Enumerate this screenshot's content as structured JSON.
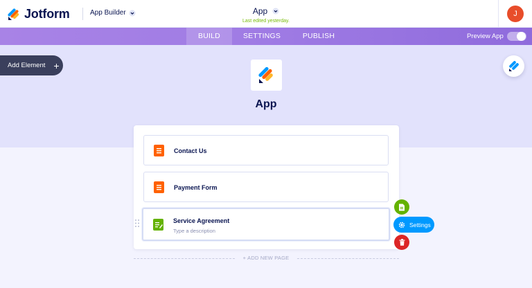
{
  "header": {
    "logo_text": "Jotform",
    "builder_label": "App Builder",
    "app_title": "App",
    "last_edited": "Last edited yesterday.",
    "avatar_initial": "J"
  },
  "nav": {
    "tabs": [
      {
        "label": "BUILD",
        "active": true
      },
      {
        "label": "SETTINGS",
        "active": false
      },
      {
        "label": "PUBLISH",
        "active": false
      }
    ],
    "preview_label": "Preview App",
    "preview_enabled": false
  },
  "hero": {
    "add_element_label": "Add Element",
    "app_name": "App"
  },
  "pages": [
    {
      "label": "Contact Us",
      "description": "",
      "icon": "form-icon",
      "color": "#ff6100"
    },
    {
      "label": "Payment Form",
      "description": "",
      "icon": "form-icon",
      "color": "#ff6100"
    },
    {
      "label": "Service Agreement",
      "description": "Type a description",
      "icon": "sign-document-icon",
      "color": "#64b200",
      "selected": true
    }
  ],
  "actions": {
    "settings_label": "Settings"
  },
  "footer": {
    "add_new_page": "+ ADD NEW PAGE"
  },
  "colors": {
    "brand_navy": "#0a1551",
    "nav_purple": "#9f7be4",
    "accent_blue": "#0099ff",
    "green": "#64b200",
    "red": "#dc2626",
    "orange": "#ff6100"
  }
}
